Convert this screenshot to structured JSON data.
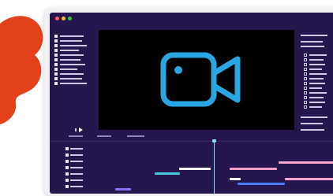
{
  "theme": {
    "splash": "#e2411a",
    "frame": "#f1f1f4",
    "app_bg": "#25164d",
    "viewer_bg": "#000000",
    "icon_color": "#2aa7e2",
    "dot_red": "#ff5f57",
    "dot_yellow": "#ffbd2e",
    "dot_green": "#28c840"
  },
  "menu": {
    "items": [
      "",
      "",
      ""
    ]
  },
  "viewer": {
    "icon": "video-camera-icon"
  },
  "timeline": {
    "clips": [
      {
        "color": "#f7a6c9"
      },
      {
        "color": "#46c9e0"
      },
      {
        "color": "#ffffff"
      },
      {
        "color": "#f2a0c4"
      },
      {
        "color": "#ffffff"
      },
      {
        "color": "#4a78ff"
      },
      {
        "color": "#f7a6c9"
      },
      {
        "color": "#8a6fff"
      }
    ]
  }
}
